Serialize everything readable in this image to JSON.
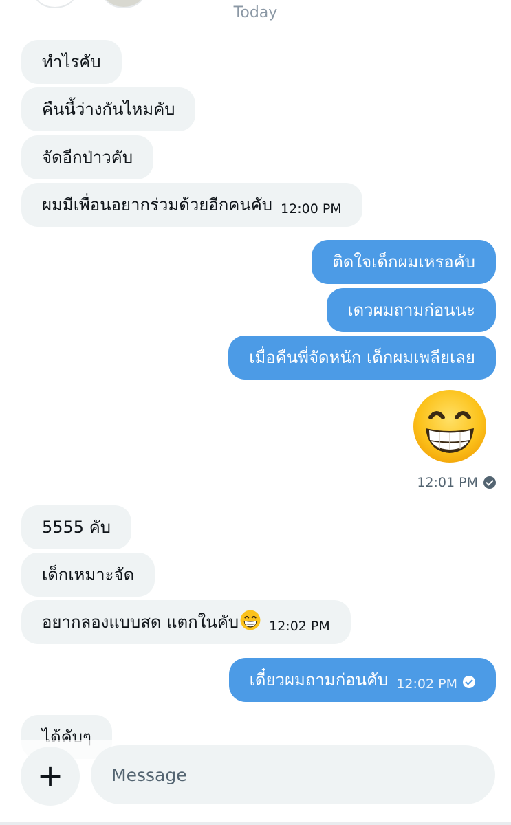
{
  "chat": {
    "date_separator": "Today",
    "messages": [
      {
        "dir": "in",
        "text": "ทำไรคับ"
      },
      {
        "dir": "in",
        "text": "คืนนี้ว่างกันไหมคับ"
      },
      {
        "dir": "in",
        "text": "จัดอีกป่าวคับ"
      },
      {
        "dir": "in",
        "text": "ผมมีเพื่อนอยากร่วมด้วยอีกคนคับ",
        "time": "12:00 PM"
      },
      {
        "dir": "out",
        "text": "ติดใจเด็กผมเหรอคับ"
      },
      {
        "dir": "out",
        "text": "เดวผมถามก่อนนะ"
      },
      {
        "dir": "out",
        "text": "เมื่อคืนพี่จัดหนัก เด็กผมเพลียเลย"
      },
      {
        "dir": "out",
        "emoji": "grinning-face-with-smiling-eyes",
        "time": "12:01 PM"
      },
      {
        "dir": "in",
        "text": "5555 คับ"
      },
      {
        "dir": "in",
        "text": "เด็กเหมาะจัด"
      },
      {
        "dir": "in",
        "text": "อยากลองแบบสด แตกในคับ",
        "emoji": "grinning-face-with-smiling-eyes",
        "time": "12:02 PM"
      },
      {
        "dir": "out",
        "text": "เดี๋ยวผมถามก่อนคับ",
        "time": "12:02 PM"
      },
      {
        "dir": "in",
        "text": "ได้คับๆ"
      }
    ]
  },
  "composer": {
    "add_icon": "plus-icon",
    "placeholder": "Message"
  },
  "colors": {
    "outgoing_bubble": "#4c9be6",
    "incoming_bubble": "#eff3f4",
    "timestamp_grey": "#536471"
  }
}
